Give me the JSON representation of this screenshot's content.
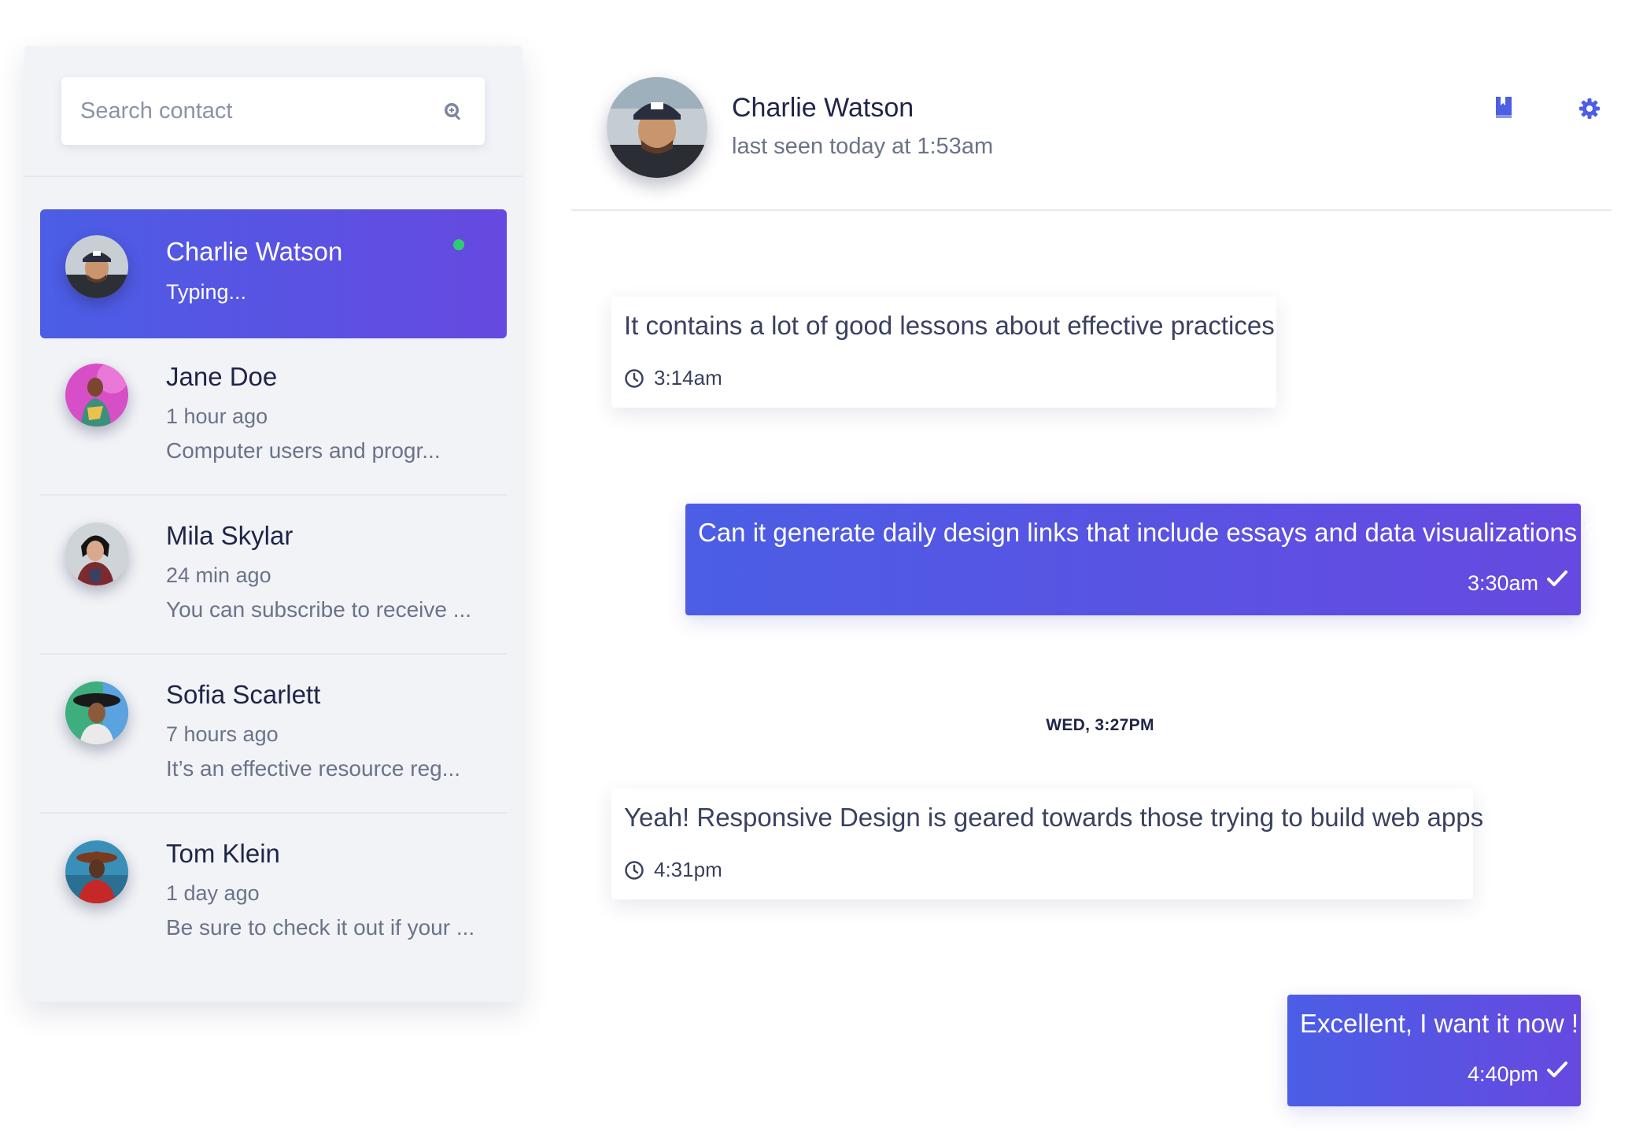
{
  "search": {
    "placeholder": "Search contact"
  },
  "contacts": [
    {
      "name": "Charlie Watson",
      "status": "Typing...",
      "active": true,
      "online": true
    },
    {
      "name": "Jane Doe",
      "time": "1 hour ago",
      "preview": "Computer users and progr..."
    },
    {
      "name": "Mila Skylar",
      "time": "24 min ago",
      "preview": "You can subscribe to receive ..."
    },
    {
      "name": "Sofia Scarlett",
      "time": "7 hours ago",
      "preview": "It’s an effective resource reg..."
    },
    {
      "name": "Tom Klein",
      "time": "1 day ago",
      "preview": "Be sure to check it out if your ..."
    }
  ],
  "header": {
    "name": "Charlie Watson",
    "status": "last seen today at 1:53am"
  },
  "messages": [
    {
      "direction": "in",
      "text": "It contains a lot of good lessons about effective practices",
      "time": "3:14am"
    },
    {
      "direction": "out",
      "text": "Can it generate daily design links that include essays and data visualizations ?",
      "time": "3:30am",
      "read": true
    },
    {
      "direction": "in",
      "text": "Yeah! Responsive Design is geared towards those trying to build web apps",
      "time": "4:31pm"
    },
    {
      "direction": "out",
      "text": "Excellent, I want it now !",
      "time": "4:40pm",
      "read": true
    }
  ],
  "date_separator": "WED, 3:27PM",
  "colors": {
    "accent_start": "#4b5ee5",
    "accent_end": "#6649e0",
    "online": "#2ecc71",
    "icon": "#4b5ee5"
  },
  "icons": [
    "search-icon",
    "bookmark-icon",
    "gear-icon",
    "clock-icon",
    "check-icon"
  ]
}
